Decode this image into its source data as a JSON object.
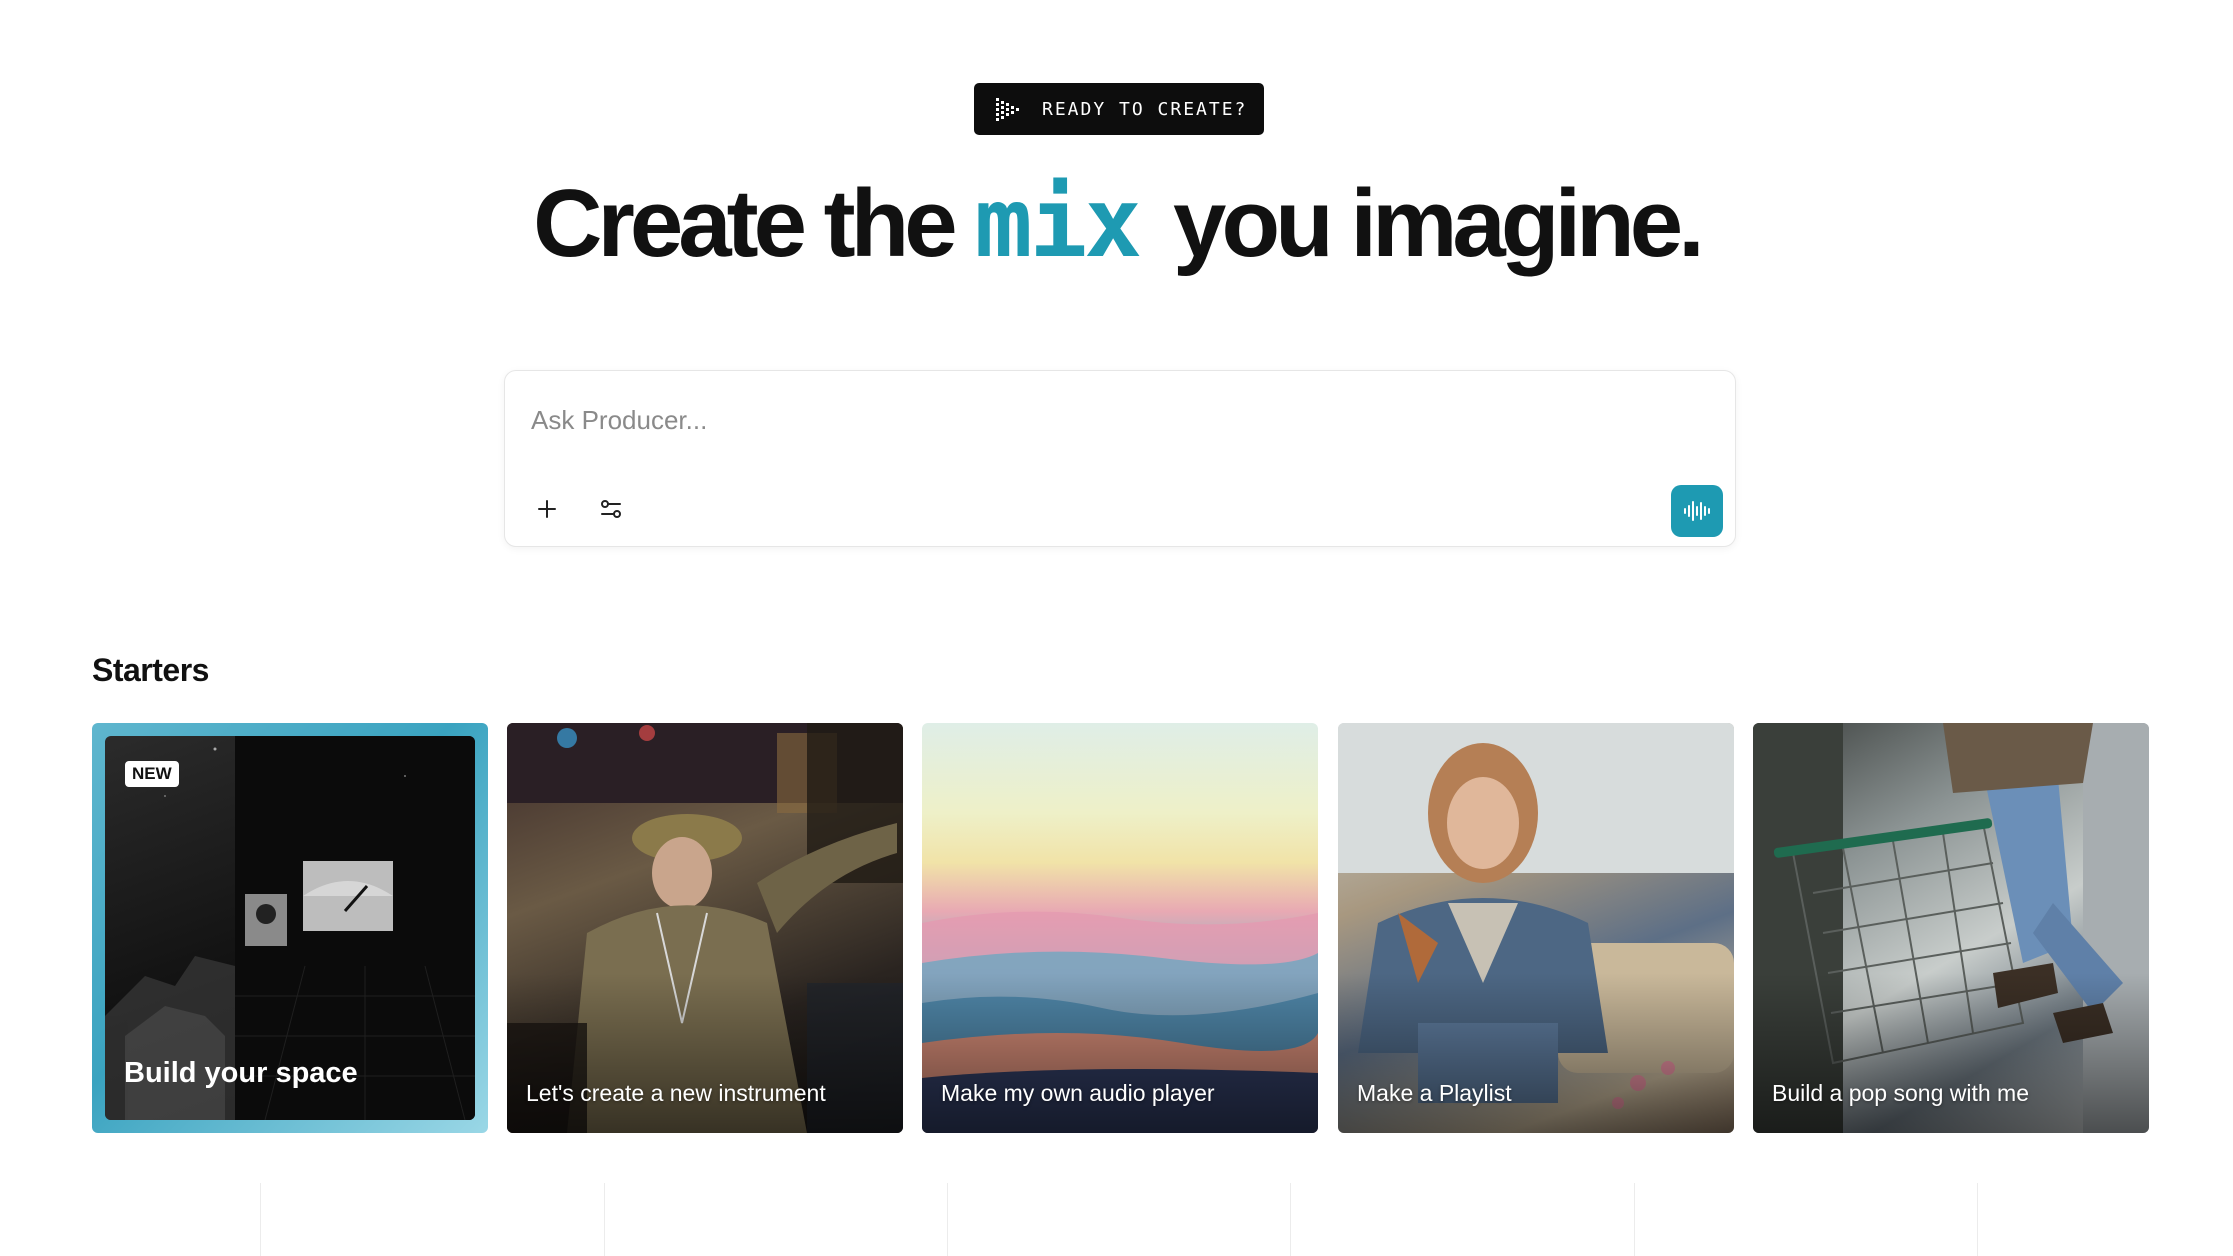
{
  "header": {
    "badge_label": "READY TO CREATE?",
    "headline_before": "Create the",
    "headline_accent": "mix",
    "headline_after": "you imagine.",
    "accent_color": "#1e9ab2"
  },
  "prompt": {
    "placeholder": "Ask Producer...",
    "value": "",
    "add_icon": "plus-icon",
    "settings_icon": "sliders-icon",
    "voice_icon": "waveform-icon"
  },
  "starters": {
    "title": "Starters",
    "cards": [
      {
        "label": "Build your space",
        "tag": "NEW"
      },
      {
        "label": "Let's create a new instrument"
      },
      {
        "label": "Make my own audio player"
      },
      {
        "label": "Make a Playlist"
      },
      {
        "label": "Build a pop song with me"
      }
    ]
  }
}
